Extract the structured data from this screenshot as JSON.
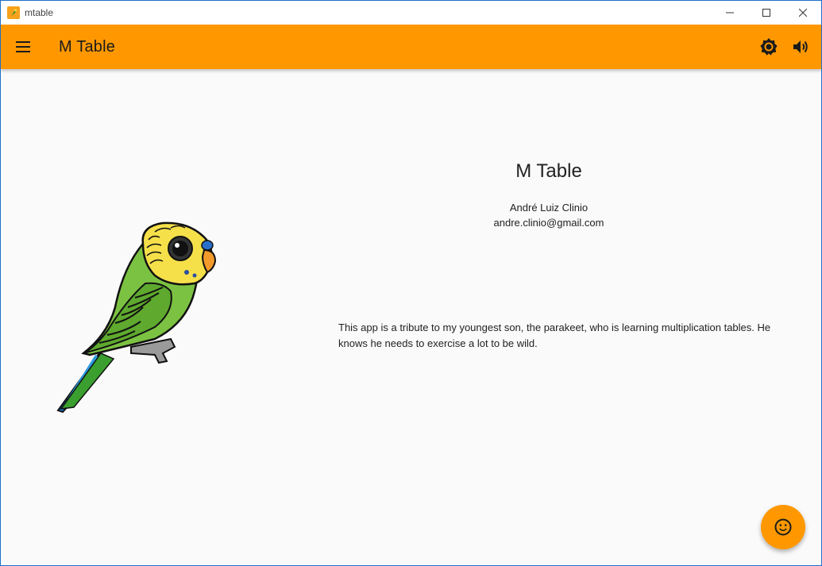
{
  "window": {
    "title": "mtable",
    "controls": [
      "minimize",
      "maximize",
      "close"
    ]
  },
  "appbar": {
    "title": "M Table",
    "menu_icon": "hamburger-menu-icon",
    "actions": [
      {
        "name": "brightness",
        "icon": "brightness-icon"
      },
      {
        "name": "volume",
        "icon": "volume-icon"
      }
    ]
  },
  "about": {
    "title": "M Table",
    "author": "André Luiz Clinio",
    "email": "andre.clinio@gmail.com",
    "description": "This app is a tribute to my youngest son, the parakeet, who is learning multiplication tables. He knows he needs to exercise a lot to be wild."
  },
  "fab": {
    "icon": "smiley-face-icon"
  },
  "colors": {
    "primary": "#ff9800",
    "background": "#fafafa",
    "text": "#222222"
  }
}
